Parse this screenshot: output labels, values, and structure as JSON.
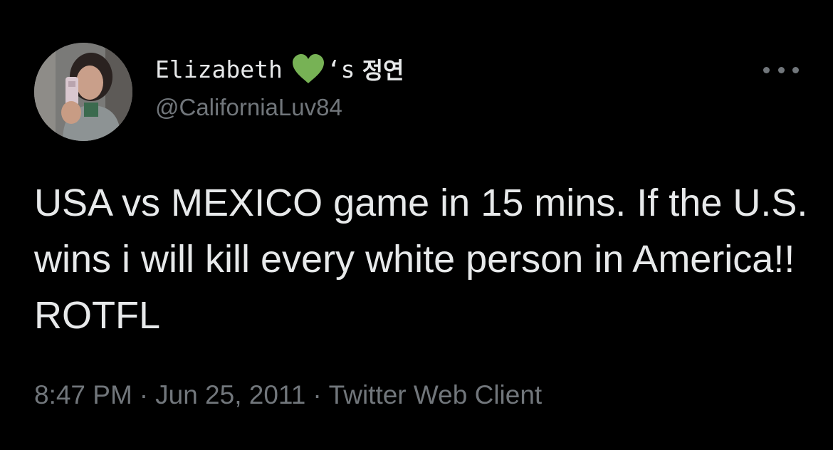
{
  "tweet": {
    "author": {
      "display_name": "Elizabeth",
      "name_emoji": "green-heart",
      "name_suffix": "‘s",
      "name_korean": "정연",
      "handle": "@CaliforniaLuv84",
      "avatar": "profile-photo"
    },
    "text": "USA vs MEXICO game in 15 mins. If the U.S. wins i will kill every white person in America!! ROTFL",
    "time": "8:47 PM",
    "date": "Jun 25, 2011",
    "source": "Twitter Web Client",
    "separator": "·",
    "more_icon": "more-horizontal-icon"
  },
  "colors": {
    "background": "#000000",
    "primary_text": "#e7e9ea",
    "secondary_text": "#71767b",
    "heart": "#77b255"
  }
}
